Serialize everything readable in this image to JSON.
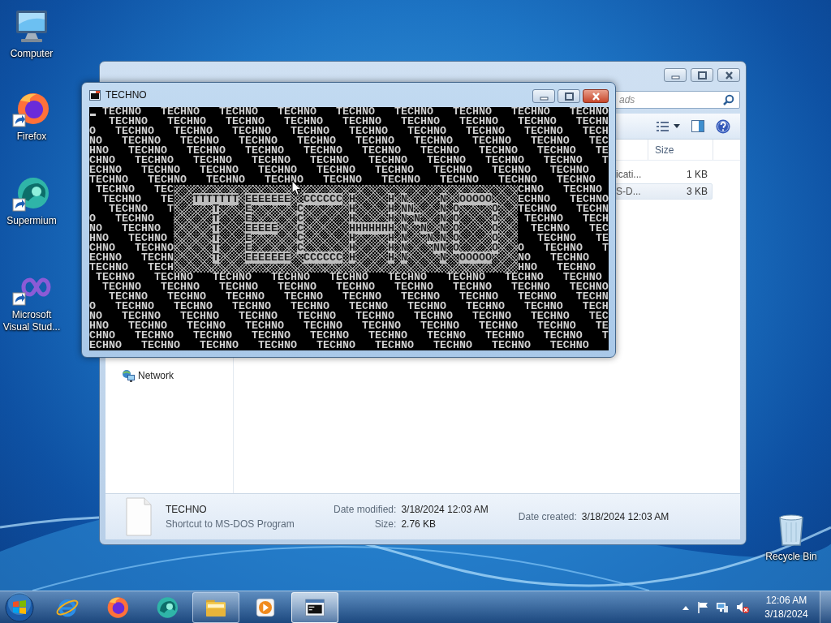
{
  "desktop_icons": [
    {
      "label": "Computer",
      "kind": "computer"
    },
    {
      "label": "Firefox",
      "kind": "firefox"
    },
    {
      "label": "Supermium",
      "kind": "supermium"
    },
    {
      "label": "Microsoft Visual Stud...",
      "kind": "visual-studio"
    },
    {
      "label": "Recycle Bin",
      "kind": "recycle-bin"
    }
  ],
  "explorer": {
    "search": {
      "placeholder": "ads"
    },
    "columns": [
      {
        "label": "Size"
      }
    ],
    "files": [
      {
        "name": "icati...",
        "size": "1 KB",
        "selected": false
      },
      {
        "name": "S-D...",
        "size": "3 KB",
        "selected": true
      }
    ],
    "nav_items": [
      {
        "label": "Network"
      }
    ],
    "details": {
      "name": "TECHNO",
      "type": "Shortcut to MS-DOS Program",
      "property_columns": [
        [
          {
            "label": "Date modified:",
            "value": "3/18/2024 12:03 AM"
          },
          {
            "label": "Size:",
            "value": "2.76 KB"
          }
        ],
        [
          {
            "label": "Date created:",
            "value": "3/18/2024 12:03 AM"
          }
        ]
      ]
    }
  },
  "console": {
    "title": "TECHNO",
    "cursor": true,
    "top_lines": [
      " TECHNO   TECHNO   TECHNO   TECHNO   TECHNO   TECHNO   TECHNO   TECHNO   TECHNO",
      "   TECHNO   TECHNO   TECHNO   TECHNO   TECHNO   TECHNO   TECHNO   TECHNO   TECHN",
      "O   TECHNO   TECHNO   TECHNO   TECHNO   TECHNO   TECHNO   TECHNO   TECHNO   TECH",
      "NO   TECHNO   TECHNO   TECHNO   TECHNO   TECHNO   TECHNO   TECHNO   TECHNO   TEC",
      "HNO   TECHNO   TECHNO   TECHNO   TECHNO   TECHNO   TECHNO   TECHNO   TECHNO   TE",
      "CHNO   TECHNO   TECHNO   TECHNO   TECHNO   TECHNO   TECHNO   TECHNO   TECHNO   T",
      "ECHNO   TECHNO   TECHNO   TECHNO   TECHNO   TECHNO   TECHNO   TECHNO   TECHNO",
      "TECHNO   TECHNO   TECHNO   TECHNO   TECHNO   TECHNO   TECHNO   TECHNO   TECHNO"
    ],
    "middle_rows": [
      {
        "left": " TECHNO   TEC",
        "right": "CHNO   TECHNO"
      },
      {
        "left": "  TECHNO   TE",
        "art": "   TTTTTTT EEEEEEE  CCCCCC H     H N     N  OOOOO",
        "right": "ECHNO   TECHNO"
      },
      {
        "left": "   TECHNO   T",
        "art": "      T    E       C       H     H NN    N O     O",
        "right": "TECHNO   TECHN"
      },
      {
        "left": "O   TECHNO",
        "art": "      T    E       C       H     H N N   N O     O",
        "right": " TECHNO   TECH"
      },
      {
        "left": "NO   TECHNO",
        "art": "      T    EEEEE   C       HHHHHHH N  N  N O     O",
        "right": "  TECHNO   TEC"
      },
      {
        "left": "HNO   TECHNO",
        "art": "      T    E       C       H     H N   N N O     O",
        "right": "   TECHNO   TE"
      },
      {
        "left": "CHNO   TECHNO",
        "art": "      T    E       C       H     H N    NN O     O",
        "right": "O   TECHNO   T"
      },
      {
        "left": "ECHNO   TECHN",
        "art": "      T    EEEEEEE  CCCCCC H     H N     N  OOOOO",
        "right": "NO   TECHNO"
      },
      {
        "left": "TECHNO   TECH",
        "right": "HNO   TECHNO"
      }
    ],
    "bottom_lines": [
      " TECHNO   TECHNO   TECHNO   TECHNO   TECHNO   TECHNO   TECHNO   TECHNO   TECHNO",
      "  TECHNO   TECHNO   TECHNO   TECHNO   TECHNO   TECHNO   TECHNO   TECHNO   TECHNO",
      "   TECHNO   TECHNO   TECHNO   TECHNO   TECHNO   TECHNO   TECHNO   TECHNO   TECHN",
      "O   TECHNO   TECHNO   TECHNO   TECHNO   TECHNO   TECHNO   TECHNO   TECHNO   TECH",
      "NO   TECHNO   TECHNO   TECHNO   TECHNO   TECHNO   TECHNO   TECHNO   TECHNO   TEC",
      "HNO   TECHNO   TECHNO   TECHNO   TECHNO   TECHNO   TECHNO   TECHNO   TECHNO   TE",
      "CHNO   TECHNO   TECHNO   TECHNO   TECHNO   TECHNO   TECHNO   TECHNO   TECHNO   T",
      "ECHNO   TECHNO   TECHNO   TECHNO   TECHNO   TECHNO   TECHNO   TECHNO   TECHNO"
    ]
  },
  "taskbar": {
    "items": [
      {
        "kind": "ie",
        "running": false,
        "selected": false
      },
      {
        "kind": "firefox",
        "running": false,
        "selected": false
      },
      {
        "kind": "supermium",
        "running": false,
        "selected": false
      },
      {
        "kind": "explorer",
        "running": true,
        "selected": false
      },
      {
        "kind": "media-player",
        "running": false,
        "selected": false
      },
      {
        "kind": "console",
        "running": true,
        "selected": true
      }
    ],
    "clock": {
      "time": "12:06 AM",
      "date": "3/18/2024"
    }
  }
}
